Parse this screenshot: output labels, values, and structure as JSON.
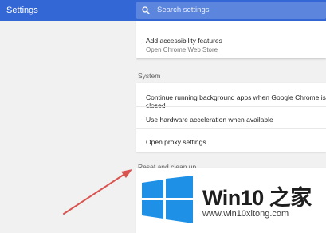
{
  "header": {
    "title": "Settings",
    "search_placeholder": "Search settings"
  },
  "accessibility": {
    "add_features_label": "Add accessibility features",
    "add_features_sub": "Open Chrome Web Store"
  },
  "system": {
    "heading": "System",
    "items": [
      {
        "label": "Continue running background apps when Google Chrome is closed"
      },
      {
        "label": "Use hardware acceleration when available"
      },
      {
        "label": "Open proxy settings"
      }
    ]
  },
  "reset": {
    "heading": "Reset and clean up"
  },
  "watermark": {
    "title": "Win10 之家",
    "url": "www.win10xitong.com"
  },
  "colors": {
    "header": "#3367d6",
    "arrow": "#d9534f",
    "win_logo": "#1e90e6"
  },
  "icons": {
    "search": "search-icon",
    "arrow": "arrow-annotation-icon",
    "windows_logo": "windows-logo-icon"
  }
}
